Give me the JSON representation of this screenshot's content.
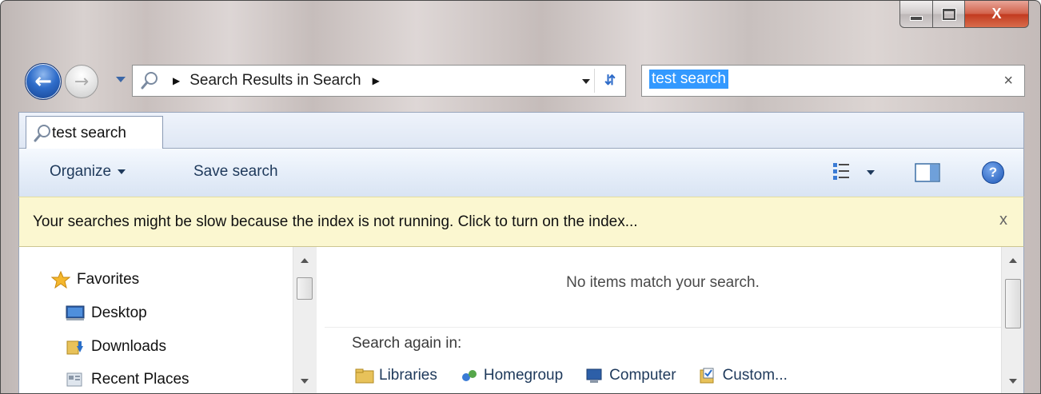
{
  "window": {
    "minimize_glyph": "",
    "close_glyph": "X"
  },
  "nav": {
    "back_glyph": "←",
    "forward_glyph": "→"
  },
  "address_bar": {
    "crumbs": [
      "Search Results in Search"
    ]
  },
  "search_box": {
    "value": "test search",
    "clear_glyph": "×"
  },
  "tab": {
    "label": "test search"
  },
  "commands": {
    "organize": "Organize",
    "save_search": "Save search",
    "help_glyph": "?"
  },
  "info_bar": {
    "message": "Your searches might be slow because the index is not running.  Click to turn on the index...",
    "close_glyph": "x"
  },
  "nav_pane": {
    "favorites": "Favorites",
    "items": [
      "Desktop",
      "Downloads",
      "Recent Places"
    ]
  },
  "results": {
    "empty_message": "No items match your search.",
    "search_again_label": "Search again in:",
    "locations": [
      "Libraries",
      "Homegroup",
      "Computer",
      "Custom..."
    ]
  },
  "colors": {
    "accent": "#2e6cc9",
    "info_bar": "#fbf7d0",
    "selection": "#3399ff",
    "close_button": "#c23a1f"
  }
}
